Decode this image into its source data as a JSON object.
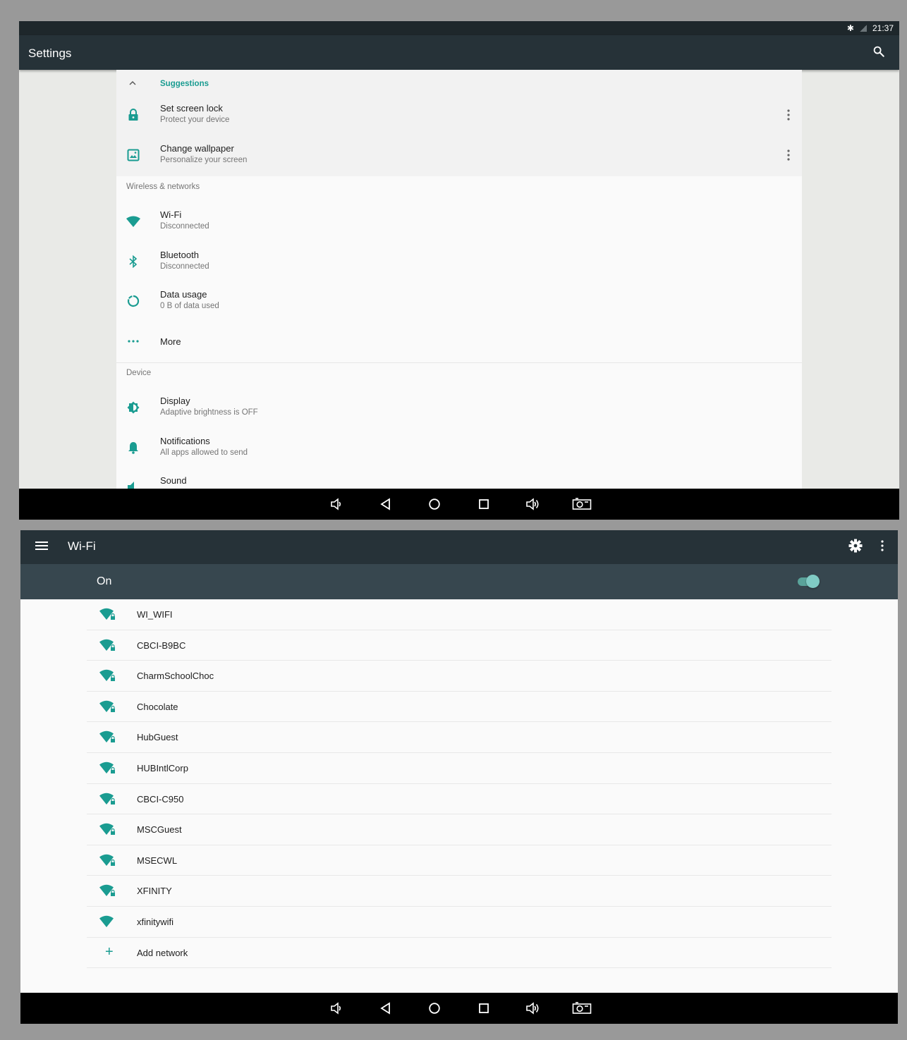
{
  "screen1": {
    "status": {
      "time": "21:37"
    },
    "app_title": "Settings",
    "suggestions": {
      "header": "Suggestions",
      "items": [
        {
          "title": "Set screen lock",
          "subtitle": "Protect your device"
        },
        {
          "title": "Change wallpaper",
          "subtitle": "Personalize your screen"
        }
      ]
    },
    "wireless_section": {
      "label": "Wireless & networks",
      "items": [
        {
          "title": "Wi-Fi",
          "subtitle": "Disconnected"
        },
        {
          "title": "Bluetooth",
          "subtitle": "Disconnected"
        },
        {
          "title": "Data usage",
          "subtitle": "0 B of data used"
        },
        {
          "title": "More"
        }
      ]
    },
    "device_section": {
      "label": "Device",
      "items": [
        {
          "title": "Display",
          "subtitle": "Adaptive brightness is OFF"
        },
        {
          "title": "Notifications",
          "subtitle": "All apps allowed to send"
        },
        {
          "title": "Sound"
        }
      ]
    }
  },
  "screen2": {
    "app_title": "Wi-Fi",
    "switch_label": "On",
    "switch_on": true,
    "networks": [
      {
        "name": "WI_WIFI",
        "locked": true
      },
      {
        "name": "CBCI-B9BC",
        "locked": true
      },
      {
        "name": "CharmSchoolChoc",
        "locked": true
      },
      {
        "name": "Chocolate",
        "locked": true
      },
      {
        "name": "HubGuest",
        "locked": true
      },
      {
        "name": "HUBIntlCorp",
        "locked": true
      },
      {
        "name": "CBCI-C950",
        "locked": true
      },
      {
        "name": "MSCGuest",
        "locked": true
      },
      {
        "name": "MSECWL",
        "locked": true
      },
      {
        "name": "XFINITY",
        "locked": true
      },
      {
        "name": "xfinitywifi",
        "locked": false
      }
    ],
    "add_network": "Add network"
  },
  "colors": {
    "accent": "#1a9c91",
    "appbar": "#263238",
    "switchbar": "#37474f"
  }
}
